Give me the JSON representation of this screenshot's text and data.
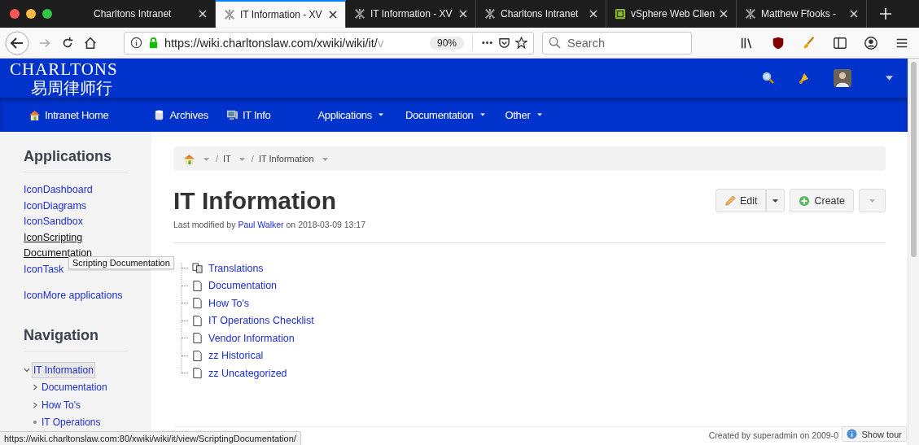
{
  "browser": {
    "tabs": [
      {
        "title": "Charltons Intranet",
        "selected": false,
        "kind": "plain"
      },
      {
        "title": "IT Information - XV",
        "selected": true,
        "kind": "wiki"
      },
      {
        "title": "IT Information - XV",
        "selected": false,
        "kind": "wiki"
      },
      {
        "title": "Charltons Intranet",
        "selected": false,
        "kind": "wiki"
      },
      {
        "title": "vSphere Web Clien",
        "selected": false,
        "kind": "vsphere"
      },
      {
        "title": "Matthew Ffooks - ",
        "selected": false,
        "kind": "wiki"
      }
    ],
    "url": "https://wiki.charltonslaw.com/xwiki/wiki/it/",
    "url_faded": "v",
    "zoom": "90%",
    "search": {
      "placeholder": "Search"
    }
  },
  "site": {
    "logo": "CHARLTONS",
    "logo_cn": "易周律师行",
    "nav": [
      {
        "label": "Intranet Home",
        "kind": "link"
      },
      {
        "label": "Archives",
        "kind": "link"
      },
      {
        "label": "IT Info",
        "kind": "link"
      },
      {
        "label": "Applications",
        "kind": "menu"
      },
      {
        "label": "Documentation",
        "kind": "menu"
      },
      {
        "label": "Other",
        "kind": "menu"
      }
    ]
  },
  "sidebar": {
    "applications": {
      "title": "Applications",
      "items": [
        {
          "alt": "Icon",
          "label": "Dashboard"
        },
        {
          "alt": "Icon",
          "label": "Diagrams"
        },
        {
          "alt": "Icon",
          "label": "Sandbox"
        },
        {
          "alt": "Icon",
          "label": "Scripting Documentation"
        },
        {
          "alt": "Icon",
          "label": "Task"
        }
      ],
      "more": {
        "alt": "Icon",
        "label": "More applications"
      }
    },
    "navigation": {
      "title": "Navigation",
      "tree": [
        {
          "label": "IT Information",
          "selected": true,
          "kind": "folder",
          "expanded": true,
          "children": [
            {
              "label": "Documentation",
              "selected": false,
              "kind": "folder"
            },
            {
              "label": "How To's",
              "selected": false,
              "kind": "folder"
            },
            {
              "label": "IT Operations",
              "selected": false,
              "kind": "leaf"
            }
          ]
        }
      ]
    }
  },
  "breadcrumb": [
    {
      "separator": "/",
      "label": "IT"
    },
    {
      "separator": "/",
      "label": "IT Information"
    }
  ],
  "page": {
    "title": "IT Information",
    "modified_prefix": "Last modified by",
    "author": "Paul Walker",
    "modified_suffix": "on 2018-03-09 13:17",
    "actions": {
      "edit": "Edit",
      "create": "Create"
    },
    "children": [
      {
        "label": "Translations",
        "kind": "translations"
      },
      {
        "label": "Documentation",
        "kind": "page"
      },
      {
        "label": "How To's",
        "kind": "page"
      },
      {
        "label": "IT Operations Checklist",
        "kind": "page"
      },
      {
        "label": "Vendor Information",
        "kind": "page"
      },
      {
        "label": "zz Historical",
        "kind": "page"
      },
      {
        "label": "zz Uncategorized",
        "kind": "page"
      }
    ],
    "footer": "Created by superadmin on 2009-0"
  },
  "tooltip": "Scripting Documentation",
  "status_url": "https://wiki.charltonslaw.com:80/xwiki/wiki/it/view/ScriptingDocumentation/",
  "show_tour": "Show tour"
}
